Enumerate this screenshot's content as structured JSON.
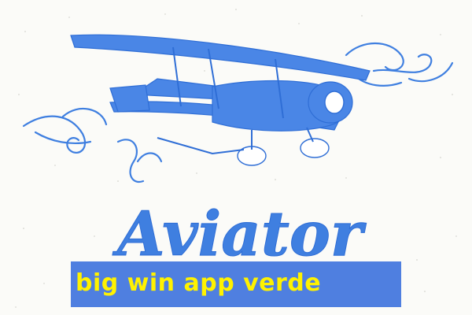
{
  "logo": {
    "wordmark": "Aviator"
  },
  "caption": {
    "text": "big win app verde"
  },
  "colors": {
    "background": "#fbfbf8",
    "ink_blue": "#3f7fe0",
    "band_blue": "#4f7fe0",
    "caption_yellow": "#fff200"
  }
}
